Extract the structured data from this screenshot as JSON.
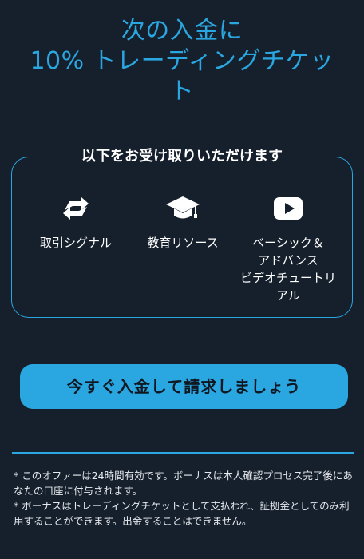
{
  "headline": {
    "line1": "次の入金に",
    "line2": "10% トレーディングチケッ",
    "line3": "ト"
  },
  "benefits": {
    "title": "以下をお受け取りいただけます",
    "items": [
      {
        "icon": "refresh-arrows-icon",
        "label_lines": [
          "取引シグナル"
        ]
      },
      {
        "icon": "graduation-cap-icon",
        "label_lines": [
          "教育リソース"
        ]
      },
      {
        "icon": "video-play-icon",
        "label_lines": [
          "ベーシック＆",
          "アドバンス",
          "ビデオチュートリ",
          "アル"
        ]
      }
    ]
  },
  "cta": {
    "label": "今すぐ入金して請求しましょう"
  },
  "footnotes": {
    "note1": "* このオファーは24時間有効です。ボーナスは本人確認プロセス完了後にあなたの口座に付与されます。",
    "note2": "* ボーナスはトレーディングチケットとして支払われ、証拠金としてのみ利用することができます。出金することはできません。"
  },
  "colors": {
    "background": "#16202c",
    "accent": "#2aa6e0",
    "text": "#ffffff"
  }
}
